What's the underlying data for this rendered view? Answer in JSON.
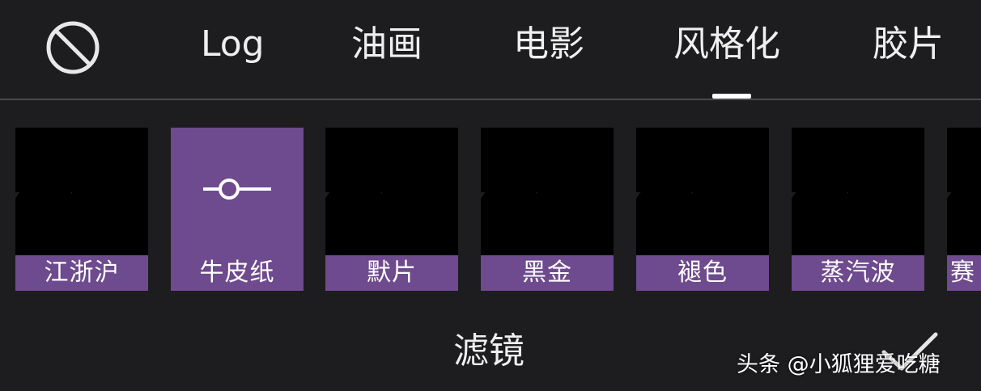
{
  "colors": {
    "background": "#1d1c1f",
    "accent_purple": "#6e4a8e",
    "text": "#efefef"
  },
  "top_tabs": {
    "none_icon": "prohibited-icon",
    "items": [
      {
        "label": "Log"
      },
      {
        "label": "油画"
      },
      {
        "label": "电影"
      },
      {
        "label": "风格化",
        "selected": true
      },
      {
        "label": "胶片"
      }
    ]
  },
  "filters": {
    "items": [
      {
        "label": "江浙沪",
        "tone": "color-orange-car"
      },
      {
        "label": "牛皮纸",
        "selected": true,
        "icon": "adjust-slider-icon"
      },
      {
        "label": "默片",
        "tone": "monochrome"
      },
      {
        "label": "黑金",
        "tone": "black-gold"
      },
      {
        "label": "褪色",
        "tone": "faded"
      },
      {
        "label": "蒸汽波",
        "tone": "vaporwave-blue"
      },
      {
        "label": "赛",
        "tone": "neon",
        "partially_visible": true
      }
    ]
  },
  "bottom": {
    "title": "滤镜",
    "confirm_icon": "check-icon"
  },
  "watermark": {
    "text": "头条 @小狐狸爱吃糖"
  }
}
